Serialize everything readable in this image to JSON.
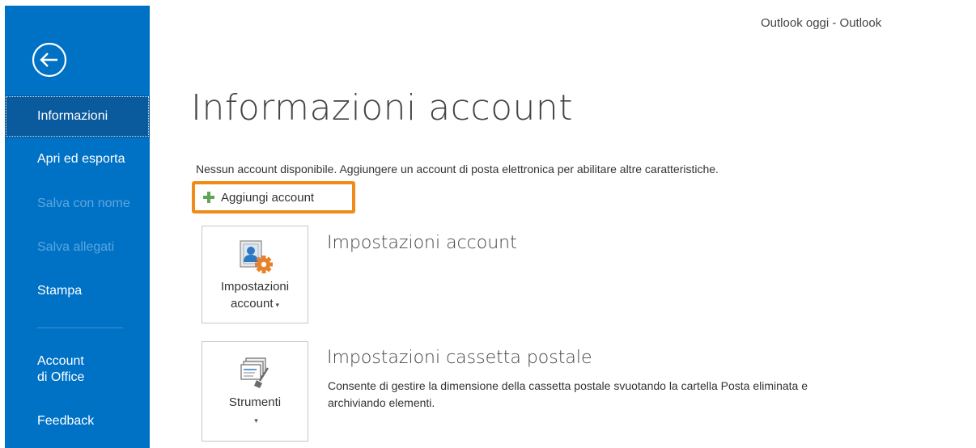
{
  "window": {
    "title": "Outlook oggi - Outlook"
  },
  "sidebar": {
    "back_icon": "back-arrow-icon",
    "items": [
      {
        "label": "Informazioni",
        "state": "active"
      },
      {
        "label": "Apri ed esporta",
        "state": "enabled"
      },
      {
        "label": "Salva con nome",
        "state": "disabled"
      },
      {
        "label": "Salva allegati",
        "state": "disabled"
      },
      {
        "label": "Stampa",
        "state": "enabled"
      },
      {
        "label_line1": "Account",
        "label_line2": "di Office",
        "state": "enabled"
      },
      {
        "label": "Feedback",
        "state": "enabled"
      }
    ]
  },
  "main": {
    "title": "Informazioni account",
    "info_text": "Nessun account disponibile. Aggiungere un account di posta elettronica per abilitare altre caratteristiche.",
    "add_account_label": "Aggiungi account",
    "add_account_icon": "plus-icon",
    "sections": [
      {
        "tile_label_line1": "Impostazioni",
        "tile_label_line2": "account",
        "tile_icon": "account-settings-icon",
        "title": "Impostazioni account",
        "description": ""
      },
      {
        "tile_label": "Strumenti",
        "tile_icon": "mailbox-cleanup-icon",
        "title": "Impostazioni cassetta postale",
        "description": "Consente di gestire la dimensione della cassetta postale svuotando la cartella Posta eliminata e archiviando elementi."
      }
    ]
  },
  "colors": {
    "sidebar_bg": "#0072c6",
    "sidebar_active_bg": "#0a5a9e",
    "sidebar_disabled_text": "#5ca6de",
    "highlight_border": "#f08a18",
    "plus_green": "#5fa457"
  }
}
